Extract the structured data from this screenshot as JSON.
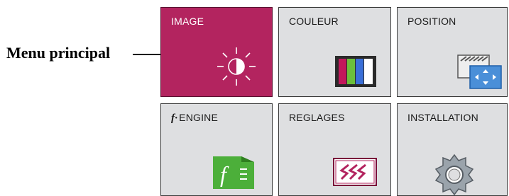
{
  "callout": {
    "label": "Menu principal"
  },
  "menu": {
    "tiles": [
      {
        "label": "IMAGE",
        "icon": "brightness-icon",
        "active": true
      },
      {
        "label": "COULEUR",
        "icon": "color-bars-icon"
      },
      {
        "label": "POSITION",
        "icon": "position-icon"
      },
      {
        "label": "ENGINE",
        "prefix": "f·",
        "icon": "f-engine-icon"
      },
      {
        "label": "REGLAGES",
        "icon": "setup-icon"
      },
      {
        "label": "INSTALLATION",
        "icon": "gear-icon"
      }
    ]
  },
  "colors": {
    "active_tile": "#b3245f",
    "inactive_tile": "#dedfe1"
  }
}
